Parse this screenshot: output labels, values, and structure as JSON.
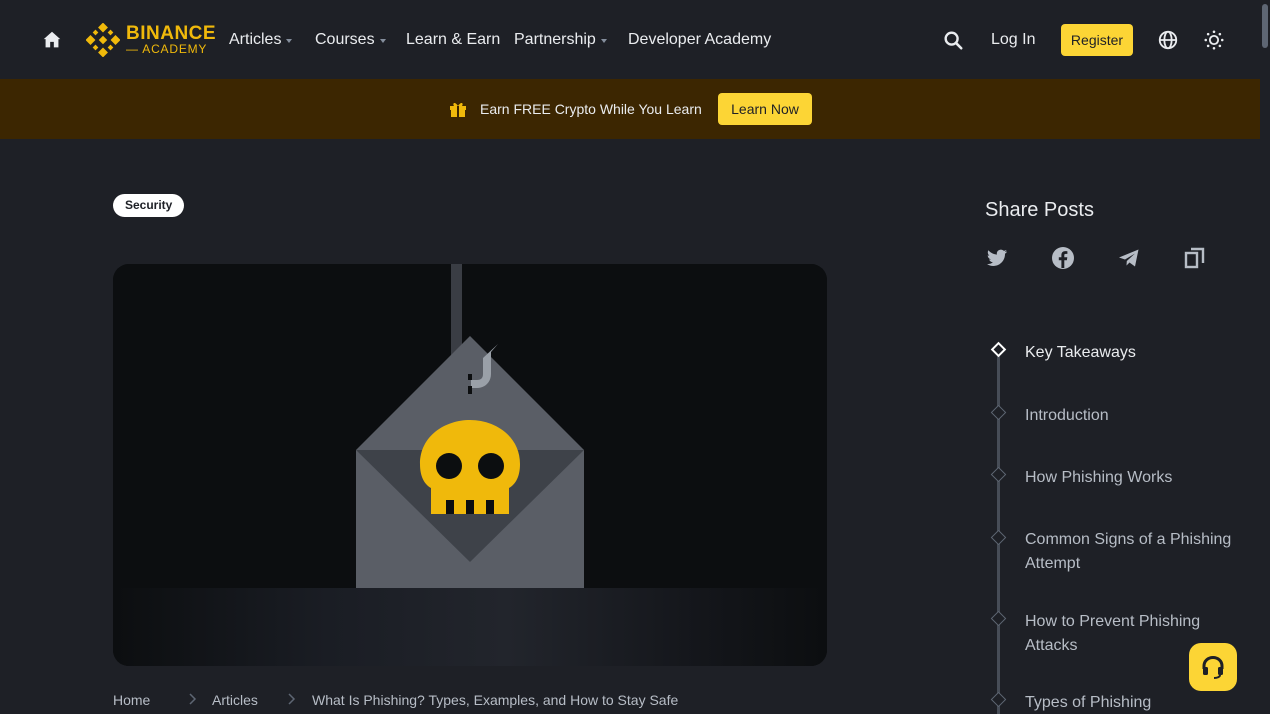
{
  "header": {
    "logo_text": "BINANCE",
    "logo_sub": "ACADEMY",
    "nav": [
      {
        "label": "Articles",
        "has_caret": true
      },
      {
        "label": "Courses",
        "has_caret": true
      },
      {
        "label": "Learn & Earn",
        "has_caret": false
      },
      {
        "label": "Partnership",
        "has_caret": true
      },
      {
        "label": "Developer Academy",
        "has_caret": false
      }
    ],
    "login_label": "Log In",
    "register_label": "Register",
    "icons": [
      "home-icon",
      "search-icon",
      "globe-icon",
      "theme-toggle-icon"
    ]
  },
  "banner": {
    "text": "Earn FREE Crypto While You Learn",
    "cta_label": "Learn Now",
    "icon": "gift-icon"
  },
  "article": {
    "tag": "Security",
    "breadcrumb": [
      "Home",
      "Articles",
      "What Is Phishing? Types, Examples, and How to Stay Safe"
    ]
  },
  "sidebar": {
    "share_title": "Share Posts",
    "share_icons": [
      "twitter-icon",
      "facebook-icon",
      "telegram-icon",
      "copy-link-icon"
    ],
    "toc": [
      {
        "label": "Key Takeaways",
        "active": true
      },
      {
        "label": "Introduction",
        "active": false
      },
      {
        "label": "How Phishing Works",
        "active": false
      },
      {
        "label": "Common Signs of a Phishing Attempt",
        "active": false
      },
      {
        "label": "How to Prevent Phishing Attacks",
        "active": false
      },
      {
        "label": "Types of Phishing",
        "active": false
      }
    ]
  },
  "colors": {
    "background": "#1e2026",
    "accent": "#fcd535",
    "brand": "#f0b90b",
    "banner": "#3c2601",
    "muted_text": "#b7bdc6"
  }
}
